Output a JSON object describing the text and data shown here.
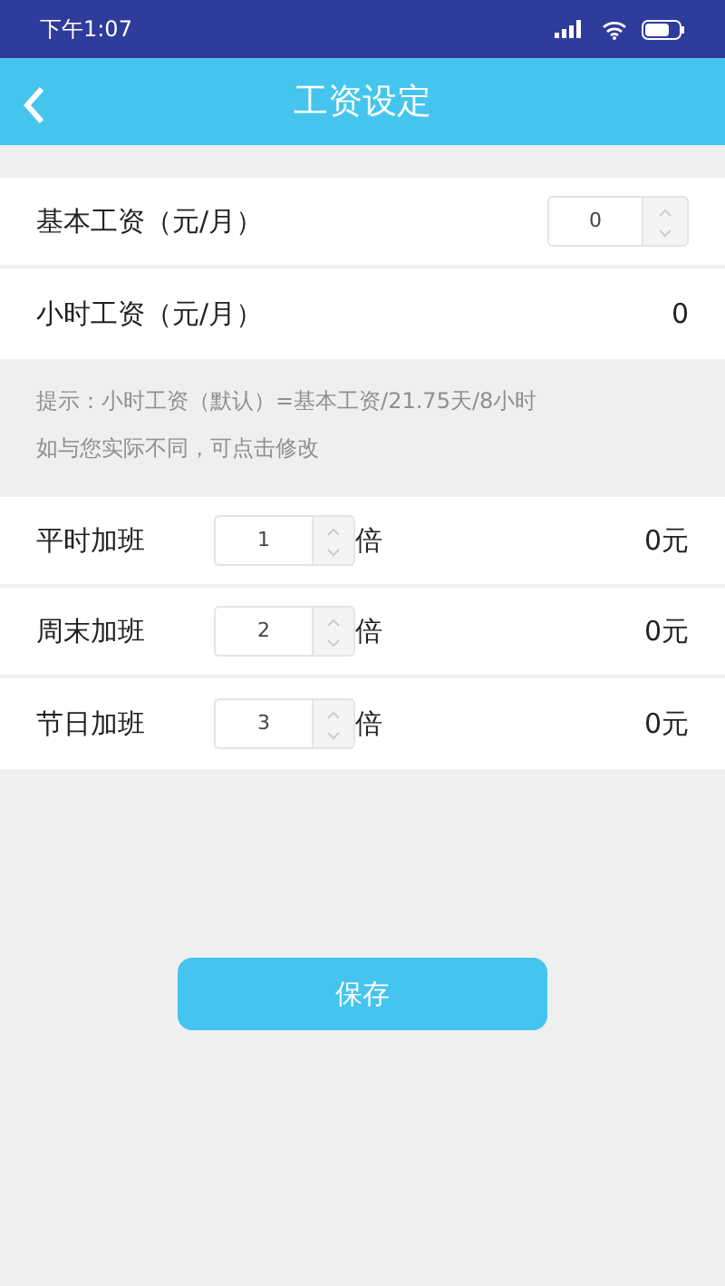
{
  "status_bar": {
    "time": "下午1:07"
  },
  "header": {
    "title": "工资设定"
  },
  "base_salary": {
    "label": "基本工资（元/月）",
    "value": "0"
  },
  "hourly_salary": {
    "label": "小时工资（元/月）",
    "value": "0"
  },
  "hint": [
    "提示：小时工资（默认）=基本工资/21.75天/8小时",
    "如与您实际不同，可点击修改"
  ],
  "overtime": [
    {
      "label": "平时加班",
      "value": "1",
      "unit": "倍",
      "amount": "0元"
    },
    {
      "label": "周末加班",
      "value": "2",
      "unit": "倍",
      "amount": "0元"
    },
    {
      "label": "节日加班",
      "value": "3",
      "unit": "倍",
      "amount": "0元"
    }
  ],
  "save_button": "保存"
}
